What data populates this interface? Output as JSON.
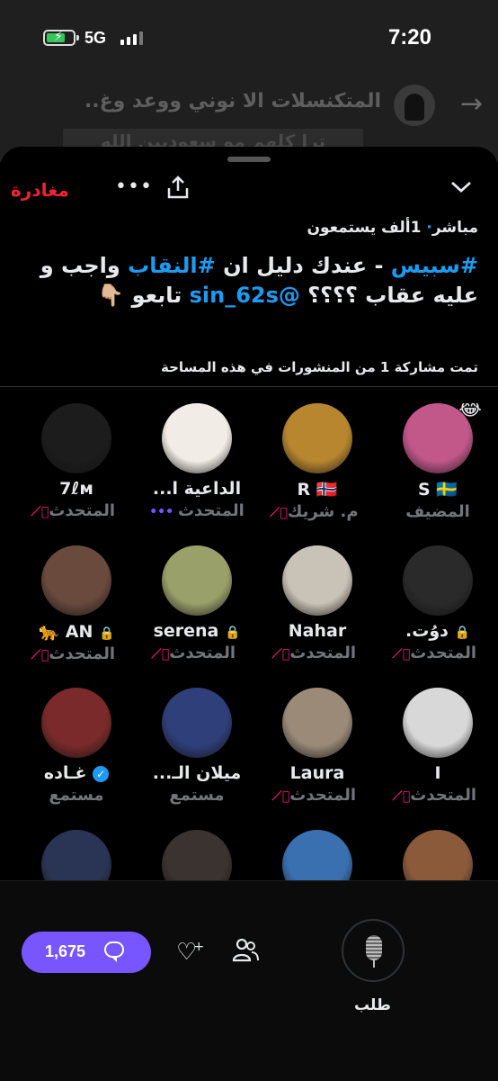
{
  "status": {
    "time": "7:20",
    "network": "5G"
  },
  "background_tweet": {
    "title": "المتكنسلات الا نوني ووعد وغ..",
    "text": "ترا كلهم مو سعوديين الله"
  },
  "space": {
    "leave_label": "مغادرة",
    "live_label": "مباشر",
    "listeners": "1ألف يستمعون",
    "title_parts": [
      {
        "text": "#سبيس",
        "hl": true
      },
      {
        "text": " - عندك دليل ان ",
        "hl": false
      },
      {
        "text": "#النقاب",
        "hl": true
      },
      {
        "text": " واجب و عليه عقاب ؟؟؟؟ ",
        "hl": false
      },
      {
        "text": "@sin_62s",
        "hl": true
      },
      {
        "text": " تابعو 👇🏼",
        "hl": false
      }
    ],
    "shared_note": "تمت مشاركة 1 من المنشورات في هذه المساحة"
  },
  "participants": [
    {
      "name": "S 🇸🇪",
      "role": "المضيف",
      "emoji": "😂",
      "avatar_color": "#c2578a",
      "muted": false
    },
    {
      "name": "R 🇳🇴",
      "role": "م. شريك",
      "avatar_color": "#b8862f",
      "muted": true
    },
    {
      "name": "الداعية ا...",
      "role": "المتحدث",
      "avatar_color": "#f2ece6",
      "muted": false,
      "speaking": true
    },
    {
      "name": "7ℓм",
      "role": "المتحدث",
      "avatar_color": "#1c1c1c",
      "muted": true
    },
    {
      "name": "دوُت.",
      "role": "المتحدث",
      "avatar_color": "#2a2a2a",
      "muted": true,
      "lock": true
    },
    {
      "name": "Nahar",
      "role": "المتحدث",
      "avatar_color": "#c9c2b6",
      "muted": true
    },
    {
      "name": "serena",
      "role": "المتحدث",
      "avatar_color": "#9aa06a",
      "muted": true,
      "lock": true
    },
    {
      "name": "AN 🐆",
      "role": "المتحدث",
      "avatar_color": "#6b4a3e",
      "muted": true,
      "lock": true
    },
    {
      "name": "I",
      "role": "المتحدث",
      "avatar_color": "#d8d8d8",
      "muted": true
    },
    {
      "name": "Laura",
      "role": "المتحدث",
      "avatar_color": "#9b8a78",
      "muted": true
    },
    {
      "name": "ميلان الـ...",
      "role": "مستمع",
      "avatar_color": "#2f3f7a",
      "muted": false
    },
    {
      "name": "غـاده",
      "role": "مستمع",
      "avatar_color": "#7a2a2a",
      "muted": false,
      "verified": true
    },
    {
      "name": "",
      "role": "",
      "avatar_color": "#8a5a3a",
      "muted": false
    },
    {
      "name": "",
      "role": "",
      "avatar_color": "#3a6fb0",
      "muted": false
    },
    {
      "name": "",
      "role": "",
      "avatar_color": "#3a3330",
      "muted": false
    },
    {
      "name": "",
      "role": "",
      "avatar_color": "#2a3555",
      "muted": false
    }
  ],
  "bottom": {
    "reply_count": "1,675",
    "request_label": "طلب"
  },
  "colors": {
    "accent": "#7856ff",
    "link": "#1d9bf0",
    "danger": "#f4212e",
    "mute": "#f91880"
  }
}
